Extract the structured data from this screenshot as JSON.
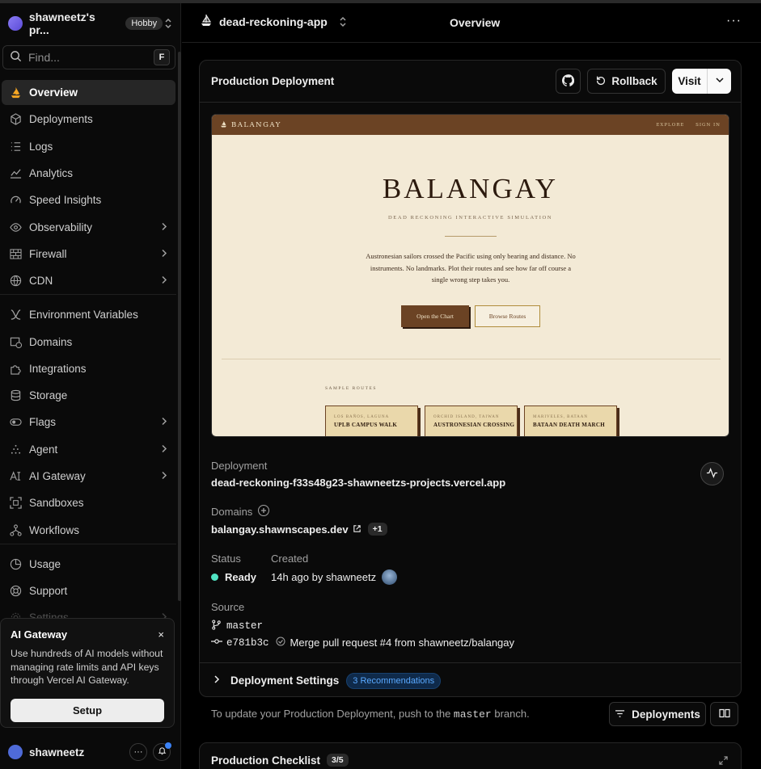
{
  "team": {
    "name": "shawneetz's pr...",
    "plan": "Hobby"
  },
  "search": {
    "placeholder": "Find...",
    "shortcut": "F"
  },
  "nav": [
    {
      "label": "Overview",
      "icon": "vercel-ship-icon",
      "active": true
    },
    {
      "label": "Deployments",
      "icon": "cube-icon"
    },
    {
      "label": "Logs",
      "icon": "logs-icon"
    },
    {
      "label": "Analytics",
      "icon": "line-chart-icon"
    },
    {
      "label": "Speed Insights",
      "icon": "gauge-icon"
    },
    {
      "label": "Observability",
      "icon": "eye-icon",
      "expandable": true
    },
    {
      "label": "Firewall",
      "icon": "brick-wall-icon",
      "expandable": true
    },
    {
      "label": "CDN",
      "icon": "globe-icon",
      "expandable": true
    },
    {
      "label": "Environment Variables",
      "icon": "env-icon"
    },
    {
      "label": "Domains",
      "icon": "domain-globe-icon"
    },
    {
      "label": "Integrations",
      "icon": "puzzle-icon"
    },
    {
      "label": "Storage",
      "icon": "database-icon"
    },
    {
      "label": "Flags",
      "icon": "toggle-icon",
      "expandable": true
    },
    {
      "label": "Agent",
      "icon": "sparkle-triangle-icon",
      "expandable": true
    },
    {
      "label": "AI Gateway",
      "icon": "ai-gateway-icon",
      "expandable": true
    },
    {
      "label": "Sandboxes",
      "icon": "sandbox-icon"
    },
    {
      "label": "Workflows",
      "icon": "workflow-icon"
    },
    {
      "label": "Usage",
      "icon": "pie-chart-icon"
    },
    {
      "label": "Support",
      "icon": "lifebuoy-icon"
    },
    {
      "label": "Settings",
      "icon": "gear-icon",
      "expandable": true
    }
  ],
  "promo": {
    "title": "AI Gateway",
    "close": "×",
    "description": "Use hundreds of AI models without managing rate limits and API keys through Vercel AI Gateway.",
    "button": "Setup"
  },
  "user": {
    "name": "shawneetz"
  },
  "header": {
    "project": "dead-reckoning-app",
    "title": "Overview",
    "more": "···"
  },
  "production": {
    "title": "Production Deployment",
    "rollback": "Rollback",
    "visit": "Visit",
    "deployment_label": "Deployment",
    "deployment_url": "dead-reckoning-f33s48g23-shawneetzs-projects.vercel.app",
    "domains_label": "Domains",
    "domain": "balangay.shawnscapes.dev",
    "domain_extra": "+1",
    "status_label": "Status",
    "status": "Ready",
    "created_label": "Created",
    "created": "14h ago by shawneetz",
    "source_label": "Source",
    "branch": "master",
    "commit": "e781b3c",
    "commit_message": "Merge pull request #4 from shawneetz/balangay",
    "settings_label": "Deployment Settings",
    "recommendations": "3 Recommendations"
  },
  "preview": {
    "brand": "BALANGAY",
    "links": "EXPLORE     SIGN IN",
    "title": "BALANGAY",
    "subtitle": "DEAD RECKONING INTERACTIVE SIMULATION",
    "paragraph": "Austronesian sailors crossed the Pacific using only bearing and distance. No instruments. No landmarks. Plot their routes and see how far off course a single wrong step takes you.",
    "primary": "Open the Chart",
    "secondary": "Browse Routes",
    "sample_label": "SAMPLE ROUTES",
    "routes": [
      {
        "sub": "LOS BAÑOS, LAGUNA",
        "name": "UPLB CAMPUS WALK"
      },
      {
        "sub": "ORCHID ISLAND, TAIWAN",
        "name": "AUSTRONESIAN CROSSING"
      },
      {
        "sub": "MARIVELES, BATAAN",
        "name": "BATAAN DEATH MARCH"
      }
    ]
  },
  "footer": {
    "text_before": "To update your Production Deployment, push to the",
    "branch": "master",
    "text_after": "branch.",
    "deployments": "Deployments"
  },
  "checklist": {
    "title": "Production Checklist",
    "progress": "3/5"
  },
  "colors": {
    "ready": "#50e3c2",
    "accent_blue": "#3b82f6",
    "preview_brown": "#6b4324",
    "preview_cream": "#f3ead6"
  }
}
